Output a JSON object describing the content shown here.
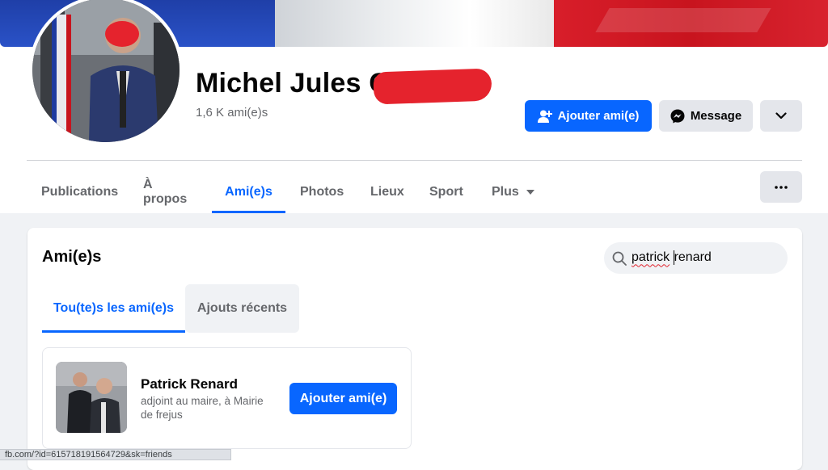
{
  "profile": {
    "name": "Michel Jules C",
    "friends_count": "1,6 K ami(e)s"
  },
  "actions": {
    "add_friend": "Ajouter ami(e)",
    "message": "Message",
    "more_icon": "chevron-down-icon"
  },
  "nav": {
    "tabs": [
      {
        "label": "Publications"
      },
      {
        "label": "À propos"
      },
      {
        "label": "Ami(e)s",
        "active": true
      },
      {
        "label": "Photos"
      },
      {
        "label": "Lieux"
      },
      {
        "label": "Sport"
      },
      {
        "label": "Plus"
      }
    ],
    "overflow_icon": "more-horizontal-icon"
  },
  "friends_section": {
    "title": "Ami(e)s",
    "search": {
      "value_part1": "patrick",
      "value_part2": "renard"
    },
    "tabs": [
      {
        "label": "Tou(te)s les ami(e)s",
        "active": true
      },
      {
        "label": "Ajouts récents"
      }
    ],
    "results": [
      {
        "name": "Patrick Renard",
        "description": "adjoint au maire, à Mairie de frejus",
        "action": "Ajouter ami(e)"
      }
    ]
  },
  "status_bar": {
    "url": "fb.com/?id=615718191564729&sk=friends"
  },
  "colors": {
    "accent": "#0866ff",
    "redaction": "#e5232d",
    "cover_blue": "#2a52c7",
    "cover_red": "#d81e2a"
  }
}
